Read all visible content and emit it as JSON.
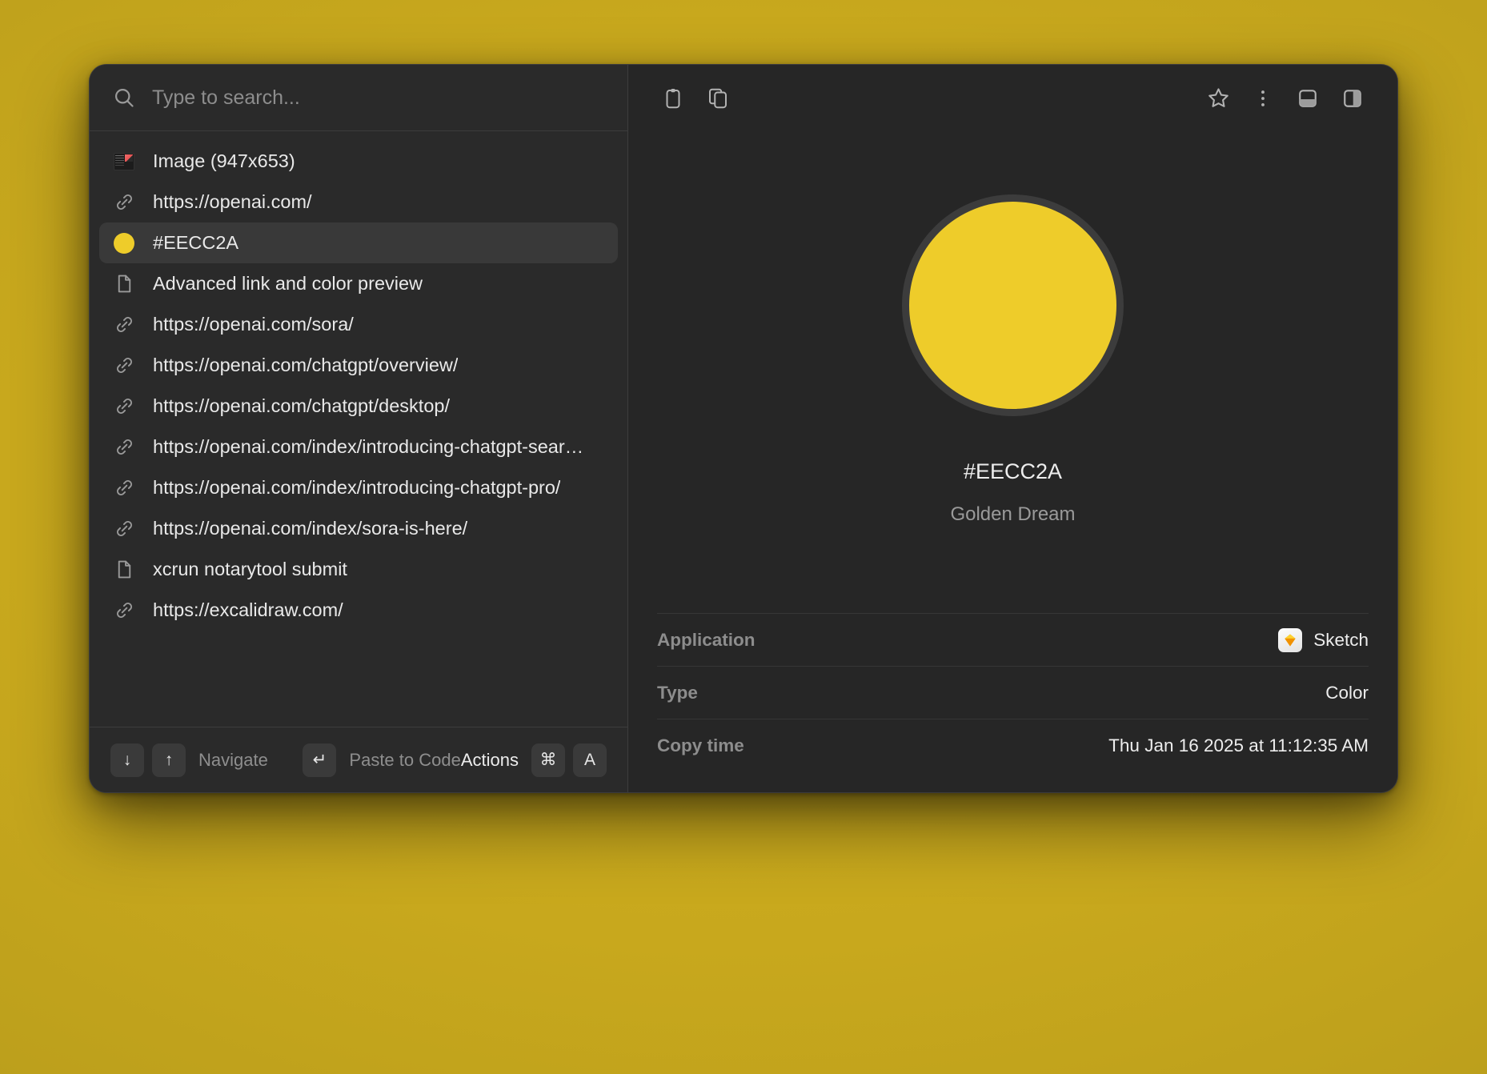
{
  "search": {
    "placeholder": "Type to search...",
    "value": "",
    "icon": "search-icon"
  },
  "clipboard_list": [
    {
      "icon": "image-thumbnail-icon",
      "label": "Image (947x653)",
      "selected": false
    },
    {
      "icon": "link-icon",
      "label": "https://openai.com/",
      "selected": false
    },
    {
      "icon": "color-swatch-icon",
      "label": "#EECC2A",
      "selected": true,
      "color": "#EECC2A"
    },
    {
      "icon": "document-icon",
      "label": "Advanced link and color preview",
      "selected": false
    },
    {
      "icon": "link-icon",
      "label": "https://openai.com/sora/",
      "selected": false
    },
    {
      "icon": "link-icon",
      "label": "https://openai.com/chatgpt/overview/",
      "selected": false
    },
    {
      "icon": "link-icon",
      "label": "https://openai.com/chatgpt/desktop/",
      "selected": false
    },
    {
      "icon": "link-icon",
      "label": "https://openai.com/index/introducing-chatgpt-sear…",
      "selected": false
    },
    {
      "icon": "link-icon",
      "label": "https://openai.com/index/introducing-chatgpt-pro/",
      "selected": false
    },
    {
      "icon": "link-icon",
      "label": "https://openai.com/index/sora-is-here/",
      "selected": false
    },
    {
      "icon": "document-icon",
      "label": "xcrun notarytool submit",
      "selected": false
    },
    {
      "icon": "link-icon",
      "label": "https://excalidraw.com/",
      "selected": false
    }
  ],
  "footer": {
    "down_key": "↓",
    "up_key": "↑",
    "navigate_label": "Navigate",
    "enter_key": "↵",
    "paste_label": "Paste to Code",
    "actions_label": "Actions",
    "cmd_key": "⌘",
    "a_key": "A"
  },
  "right_toolbar": {
    "icons": [
      "clipboard-icon",
      "copy-icon",
      "star-icon",
      "more-options-icon",
      "bottom-panel-icon",
      "side-panel-icon"
    ]
  },
  "preview": {
    "color": "#EECC2A",
    "hex_label": "#EECC2A",
    "color_name": "Golden Dream"
  },
  "metadata": [
    {
      "key": "Application",
      "value": "Sketch",
      "icon": "sketch-app-icon"
    },
    {
      "key": "Type",
      "value": "Color",
      "icon": null
    },
    {
      "key": "Copy time",
      "value": "Thu Jan 16 2025 at 11:12:35 AM",
      "icon": null
    }
  ],
  "theme": {
    "wallpaper": "#C9A81F",
    "window_bg": "#262626",
    "panel_bg": "#2A2A2A",
    "selected_bg": "#393939",
    "accent": "#EECC2A"
  }
}
